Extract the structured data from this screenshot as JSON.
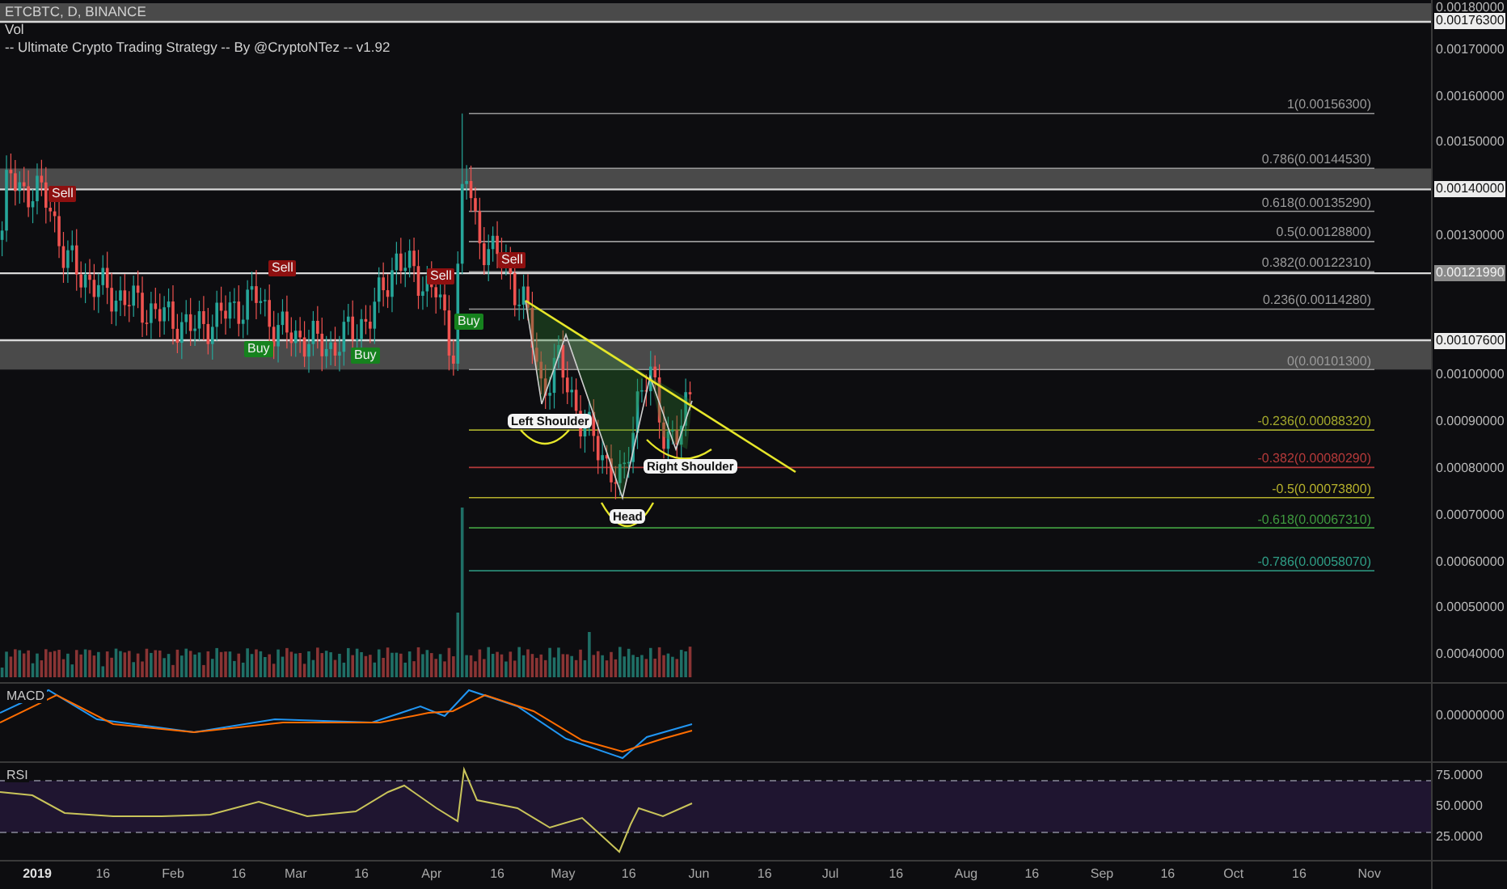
{
  "header": {
    "symbol": "ETCBTC, D, BINANCE",
    "indicators": [
      "Vol",
      "-- Ultimate Crypto Trading Strategy -- By @CryptoNTez -- v1.92"
    ]
  },
  "price_axis": [
    {
      "label": "0.00180000",
      "kind": "tick"
    },
    {
      "label": "0.00176300",
      "kind": "marker"
    },
    {
      "label": "0.00170000",
      "kind": "tick"
    },
    {
      "label": "0.00160000",
      "kind": "tick"
    },
    {
      "label": "0.00150000",
      "kind": "tick"
    },
    {
      "label": "0.00140000",
      "kind": "marker"
    },
    {
      "label": "0.00130000",
      "kind": "tick"
    },
    {
      "label": "0.00121990",
      "kind": "shade"
    },
    {
      "label": "0.00107600",
      "kind": "marker"
    },
    {
      "label": "0.00100000",
      "kind": "tick"
    },
    {
      "label": "0.00090000",
      "kind": "tick"
    },
    {
      "label": "0.00080000",
      "kind": "tick"
    },
    {
      "label": "0.00070000",
      "kind": "tick"
    },
    {
      "label": "0.00060000",
      "kind": "tick"
    },
    {
      "label": "0.00050000",
      "kind": "tick"
    },
    {
      "label": "0.00040000",
      "kind": "tick"
    }
  ],
  "fib_levels": [
    {
      "label": "1(0.00156300)",
      "color": "#9a9a9a"
    },
    {
      "label": "0.786(0.00144530)",
      "color": "#9a9a9a"
    },
    {
      "label": "0.618(0.00135290)",
      "color": "#9a9a9a"
    },
    {
      "label": "0.5(0.00128800)",
      "color": "#9a9a9a"
    },
    {
      "label": "0.382(0.00122310)",
      "color": "#9a9a9a"
    },
    {
      "label": "0.236(0.00114280)",
      "color": "#9a9a9a"
    },
    {
      "label": "0(0.00101300)",
      "color": "#9a9a9a"
    },
    {
      "label": "-0.236(0.00088320)",
      "color": "#a3a82c"
    },
    {
      "label": "-0.382(0.00080290)",
      "color": "#b53a3a"
    },
    {
      "label": "-0.5(0.00073800)",
      "color": "#b5b02c"
    },
    {
      "label": "-0.618(0.00067310)",
      "color": "#3f9a3f"
    },
    {
      "label": "-0.786(0.00058070)",
      "color": "#2f9e86"
    }
  ],
  "signals": [
    {
      "label": "Sell",
      "kind": "sell"
    },
    {
      "label": "Sell",
      "kind": "sell"
    },
    {
      "label": "Sell",
      "kind": "sell"
    },
    {
      "label": "Sell",
      "kind": "sell"
    },
    {
      "label": "Buy",
      "kind": "buy"
    },
    {
      "label": "Buy",
      "kind": "buy"
    },
    {
      "label": "Buy",
      "kind": "buy"
    }
  ],
  "pattern_labels": [
    "Left Shoulder",
    "Head",
    "Right Shoulder"
  ],
  "macd": {
    "title": "MACD",
    "axis": [
      "0.00000000"
    ]
  },
  "rsi": {
    "title": "RSI",
    "axis": [
      "75.0000",
      "50.0000",
      "25.0000"
    ]
  },
  "time_axis": [
    {
      "label": "2019",
      "kind": "year"
    },
    {
      "label": "16",
      "kind": "day"
    },
    {
      "label": "Feb",
      "kind": "month"
    },
    {
      "label": "16",
      "kind": "day"
    },
    {
      "label": "Mar",
      "kind": "month"
    },
    {
      "label": "16",
      "kind": "day"
    },
    {
      "label": "Apr",
      "kind": "month"
    },
    {
      "label": "16",
      "kind": "day"
    },
    {
      "label": "May",
      "kind": "month"
    },
    {
      "label": "16",
      "kind": "day"
    },
    {
      "label": "Jun",
      "kind": "month"
    },
    {
      "label": "16",
      "kind": "day"
    },
    {
      "label": "Jul",
      "kind": "month"
    },
    {
      "label": "16",
      "kind": "day"
    },
    {
      "label": "Aug",
      "kind": "month"
    },
    {
      "label": "16",
      "kind": "day"
    },
    {
      "label": "Sep",
      "kind": "month"
    },
    {
      "label": "16",
      "kind": "day"
    },
    {
      "label": "Oct",
      "kind": "month"
    },
    {
      "label": "16",
      "kind": "day"
    },
    {
      "label": "Nov",
      "kind": "month"
    }
  ]
}
